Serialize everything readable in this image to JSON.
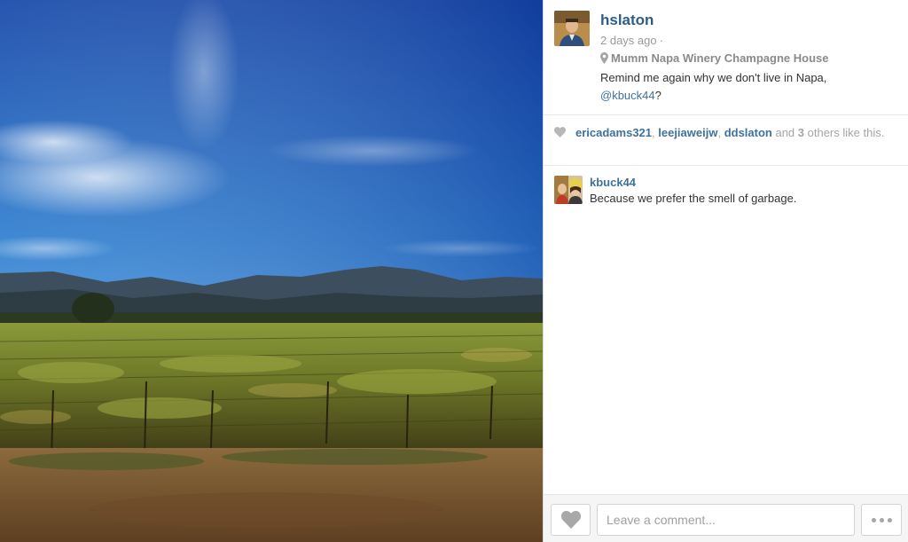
{
  "post": {
    "username": "hslaton",
    "time": "2 days ago",
    "separator": "·",
    "location": "Mumm Napa Winery Champagne House",
    "caption_text": "Remind me again why we don't live in Napa,",
    "caption_mention": "@kbuck44",
    "caption_end": "?",
    "photo_subject": "vineyard-landscape"
  },
  "likes": {
    "users": [
      "ericadams321",
      "leejiaweijw",
      "ddslaton"
    ],
    "sep1": ", ",
    "sep2": ", ",
    "and_text": " and ",
    "others_count": "3",
    "others_text": " others like this."
  },
  "comments": [
    {
      "user": "kbuck44",
      "text": "Because we prefer the smell of garbage."
    }
  ],
  "footer": {
    "comment_placeholder": "Leave a comment..."
  },
  "colors": {
    "link": "#3f729b",
    "username": "#2e5e86",
    "muted": "#999999"
  },
  "icons": {
    "location": "map-pin-icon",
    "likes": "heart-icon",
    "like_button": "heart-icon",
    "more": "ellipsis-icon"
  }
}
